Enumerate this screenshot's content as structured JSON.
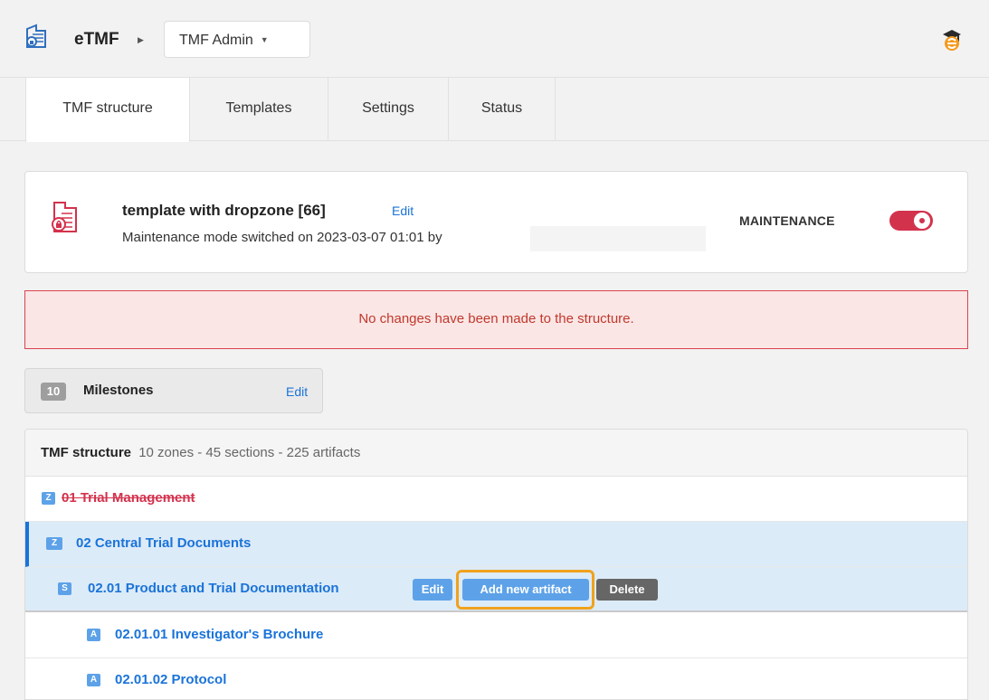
{
  "header": {
    "app_name": "eTMF",
    "study_selector": "TMF Admin"
  },
  "tabs": [
    {
      "label": "TMF structure",
      "active": true
    },
    {
      "label": "Templates",
      "active": false
    },
    {
      "label": "Settings",
      "active": false
    },
    {
      "label": "Status",
      "active": false
    }
  ],
  "template_card": {
    "title": "template with dropzone [66]",
    "edit_label": "Edit",
    "subtitle": "Maintenance mode switched on 2023-03-07 01:01 by",
    "maintenance_label": "MAINTENANCE",
    "maintenance_on": true
  },
  "alert": {
    "message": "No changes have been made to the structure."
  },
  "milestones": {
    "count": "10",
    "label": "Milestones",
    "edit_label": "Edit"
  },
  "tree": {
    "title": "TMF structure",
    "stats": "10 zones - 45 sections - 225 artifacts",
    "rows": [
      {
        "badge": "Z",
        "label": "01 Trial Management"
      },
      {
        "badge": "Z",
        "label": "02 Central Trial Documents"
      },
      {
        "badge": "S",
        "label": "02.01 Product and Trial Documentation"
      },
      {
        "badge": "A",
        "label": "02.01.01 Investigator's Brochure"
      },
      {
        "badge": "A",
        "label": "02.01.02 Protocol"
      }
    ],
    "actions": {
      "edit": "Edit",
      "add_artifact": "Add new artifact",
      "delete": "Delete"
    }
  },
  "colors": {
    "accent": "#1a73d9",
    "danger": "#d3324d",
    "highlight": "#f0a21c"
  }
}
